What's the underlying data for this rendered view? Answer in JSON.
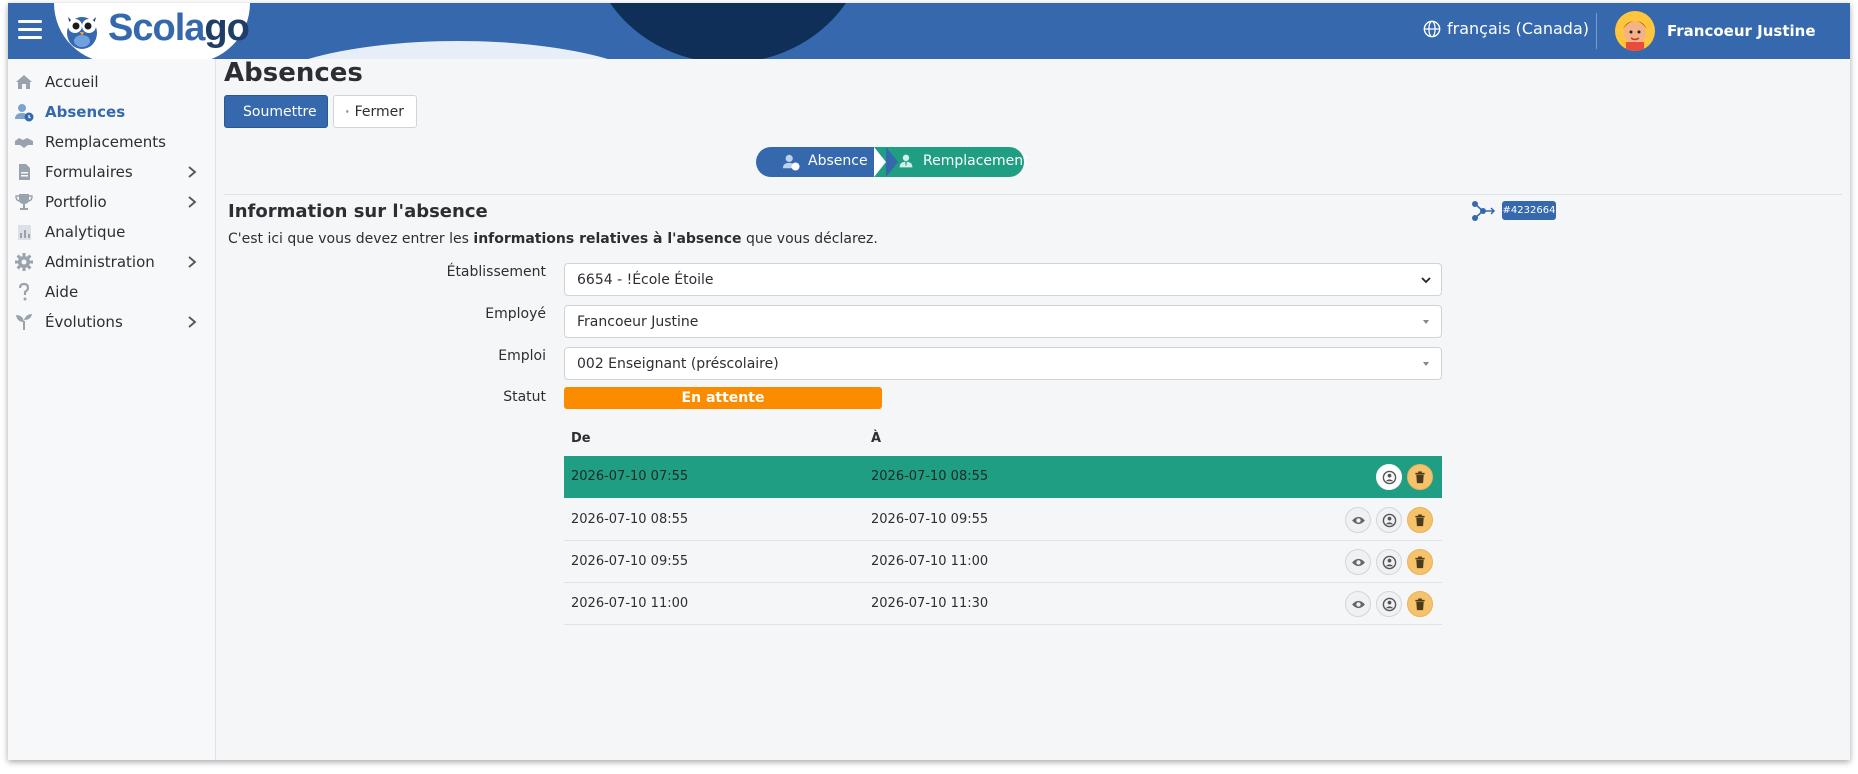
{
  "header": {
    "logo": {
      "part1": "Scola",
      "part2": "go"
    },
    "language": "français (Canada)",
    "user_name": "Francoeur Justine"
  },
  "sidebar": {
    "items": [
      {
        "label": "Accueil",
        "icon": "home-icon",
        "has_submenu": false,
        "active": false
      },
      {
        "label": "Absences",
        "icon": "user-clock-icon",
        "has_submenu": false,
        "active": true
      },
      {
        "label": "Remplacements",
        "icon": "handshake-icon",
        "has_submenu": false,
        "active": false
      },
      {
        "label": "Formulaires",
        "icon": "file-icon",
        "has_submenu": true,
        "active": false
      },
      {
        "label": "Portfolio",
        "icon": "trophy-icon",
        "has_submenu": true,
        "active": false
      },
      {
        "label": "Analytique",
        "icon": "chart-icon",
        "has_submenu": false,
        "active": false
      },
      {
        "label": "Administration",
        "icon": "gear-icon",
        "has_submenu": true,
        "active": false
      },
      {
        "label": "Aide",
        "icon": "question-icon",
        "has_submenu": false,
        "active": false
      },
      {
        "label": "Évolutions",
        "icon": "sprout-icon",
        "has_submenu": true,
        "active": false
      }
    ]
  },
  "page": {
    "title": "Absences",
    "submit_label": "Soumettre",
    "close_label": "Fermer"
  },
  "steps": [
    {
      "label": "Absence",
      "color": "#3568ad"
    },
    {
      "label": "Remplacement",
      "color": "#1f9e84"
    }
  ],
  "section": {
    "title": "Information sur l'absence",
    "intro_before": "C'est ici que vous devez entrer les ",
    "intro_bold": "informations relatives à l'absence",
    "intro_after": " que vous déclarez.",
    "id_badge": "#4232664"
  },
  "form": {
    "etablissement": {
      "label": "Établissement",
      "value": "6654 - !École Étoile"
    },
    "employe": {
      "label": "Employé",
      "value": "Francoeur Justine"
    },
    "emploi": {
      "label": "Emploi",
      "value": "002 Enseignant (préscolaire)"
    },
    "statut": {
      "label": "Statut",
      "value": "En attente",
      "color": "#fb8c00"
    }
  },
  "table": {
    "headers": {
      "from": "De",
      "to": "À"
    },
    "rows": [
      {
        "from": "2026-07-10 07:55",
        "to": "2026-07-10 08:55",
        "active": true
      },
      {
        "from": "2026-07-10 08:55",
        "to": "2026-07-10 09:55",
        "active": false
      },
      {
        "from": "2026-07-10 09:55",
        "to": "2026-07-10 11:00",
        "active": false
      },
      {
        "from": "2026-07-10 11:00",
        "to": "2026-07-10 11:30",
        "active": false
      }
    ]
  },
  "colors": {
    "brand": "#3568ad",
    "success": "#1f9e84",
    "warning": "#fb8c00",
    "delete": "#f6c26b"
  }
}
